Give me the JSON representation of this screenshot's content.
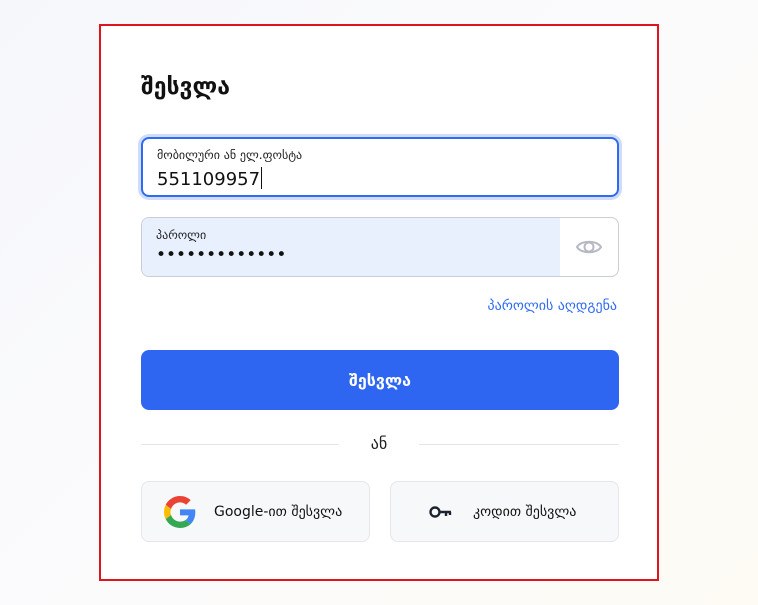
{
  "form": {
    "title": "შესვლა",
    "phone_label": "მობილური ან ელ.ფოსტა",
    "phone_value": "551109957",
    "password_label": "პაროლი",
    "password_value": "•••••••••••••",
    "forgot_link": "პაროლის აღდგენა",
    "submit_label": "შესვლა",
    "divider": "ან",
    "google_label": "Google-ით შესვლა",
    "code_label": "კოდით შესვლა"
  },
  "icons": {
    "password_toggle": "eye-icon",
    "google": "google-icon",
    "code": "key-icon"
  },
  "colors": {
    "accent": "#2f66f1",
    "frame": "#e0141c",
    "autofill": "#e8f0fe"
  }
}
